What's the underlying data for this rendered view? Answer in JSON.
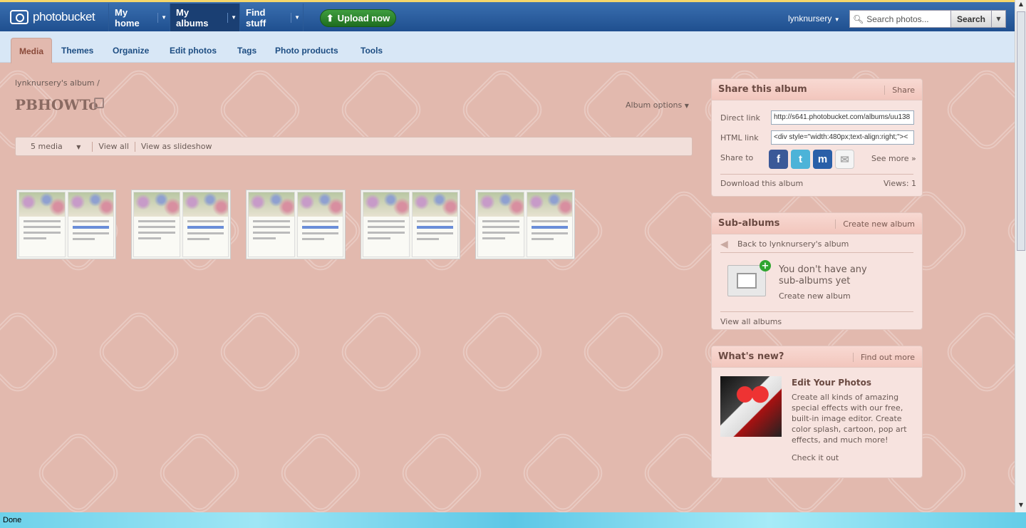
{
  "brand": {
    "name": "photobucket"
  },
  "topnav": {
    "items": [
      {
        "label": "My home"
      },
      {
        "label": "My albums"
      },
      {
        "label": "Find stuff"
      }
    ],
    "upload_label": "Upload now",
    "user": "lynknursery",
    "search_placeholder": "Search photos...",
    "search_button": "Search"
  },
  "subnav": {
    "items": [
      "Media",
      "Themes",
      "Organize",
      "Edit photos",
      "Tags",
      "Photo products",
      "Tools"
    ]
  },
  "album": {
    "breadcrumb": "lynknursery's album /",
    "title": "PBHOWTo",
    "options_label": "Album options",
    "media_count": "5 media",
    "view_all": "View all",
    "slideshow": "View as slideshow",
    "thumbnail_count": 5
  },
  "share": {
    "title": "Share this album",
    "share_link": "Share",
    "direct_label": "Direct link",
    "direct_value": "http://s641.photobucket.com/albums/uu138",
    "html_label": "HTML link",
    "html_value": "<div style=\"width:480px;text-align:right;\"><",
    "share_to": "Share to",
    "see_more": "See more »",
    "download": "Download this album",
    "views": "Views: 1"
  },
  "subalbums": {
    "title": "Sub-albums",
    "create_link": "Create new album",
    "back": "Back to lynknursery's album",
    "empty_text": "You don't have any sub-albums yet",
    "create_new": "Create new album",
    "view_all": "View all albums"
  },
  "whatsnew": {
    "title": "What's new?",
    "find_out": "Find out more",
    "promo_title": "Edit Your Photos",
    "promo_text": "Create all kinds of amazing special effects with our free, built-in image editor. Create color splash, cartoon, pop art effects, and much more!",
    "check_it_out": "Check it out"
  },
  "status": {
    "text": "Done"
  },
  "colors": {
    "topbar": "#1f4f8f",
    "subnav": "#d8e7f6",
    "background": "#e2b9ae",
    "upload": "#2a862a"
  },
  "icons": [
    "camera-icon",
    "upload-arrow-icon",
    "search-icon",
    "lock-icon",
    "facebook-icon",
    "twitter-icon",
    "myspace-icon",
    "email-icon",
    "back-arrow-icon",
    "folder-icon",
    "plus-icon"
  ]
}
